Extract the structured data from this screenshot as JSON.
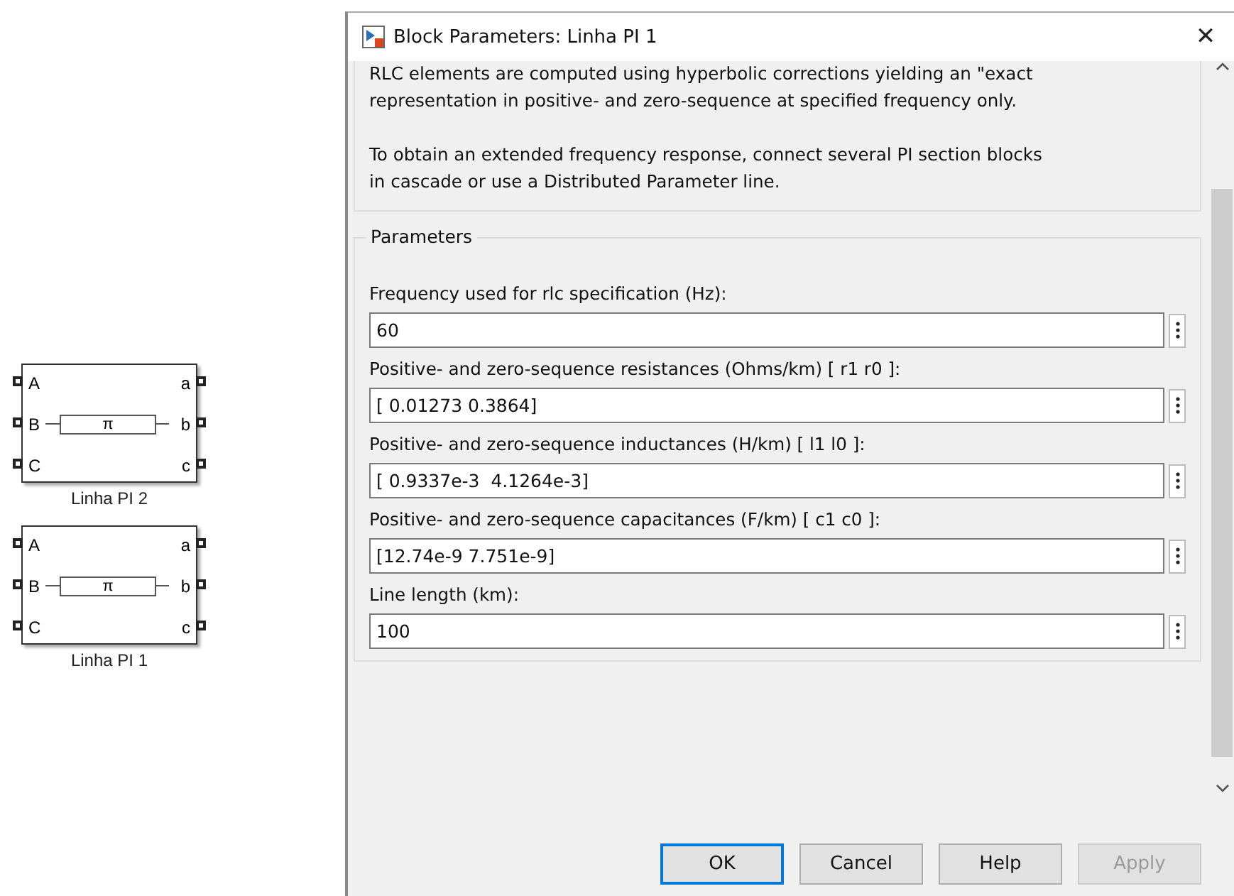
{
  "canvas": {
    "blocks": [
      {
        "name": "Linha PI 2",
        "left_ports": [
          "A",
          "B",
          "C"
        ],
        "right_ports": [
          "a",
          "b",
          "c"
        ],
        "symbol": "π"
      },
      {
        "name": "Linha PI 1",
        "left_ports": [
          "A",
          "B",
          "C"
        ],
        "right_ports": [
          "a",
          "b",
          "c"
        ],
        "symbol": "π"
      }
    ]
  },
  "dialog": {
    "title": "Block Parameters: Linha PI 1",
    "close": "✕",
    "description": [
      {
        "lines": [
          "RLC elements are computed using hyperbolic corrections yielding an \"exact",
          "representation in positive- and zero-sequence at specified frequency only."
        ]
      },
      {
        "lines": [
          "To obtain an extended frequency response, connect several PI section blocks",
          "in cascade or use a Distributed Parameter line."
        ]
      }
    ],
    "parameters": {
      "title": "Parameters",
      "fields": [
        {
          "label": "Frequency used for rlc specification (Hz):",
          "value": "60"
        },
        {
          "label": "Positive- and zero-sequence resistances (Ohms/km) [ r1  r0 ]:",
          "value": "[ 0.01273 0.3864]"
        },
        {
          "label": "Positive- and zero-sequence inductances (H/km) [ l1  l0 ]:",
          "value": "[ 0.9337e-3  4.1264e-3]"
        },
        {
          "label": "Positive- and zero-sequence capacitances (F/km) [ c1 c0 ]:",
          "value": "[12.74e-9 7.751e-9]"
        },
        {
          "label": "Line length (km):",
          "value": "100"
        }
      ]
    },
    "buttons": [
      {
        "label": "OK",
        "default": true,
        "disabled": false
      },
      {
        "label": "Cancel",
        "default": false,
        "disabled": false
      },
      {
        "label": "Help",
        "default": false,
        "disabled": false
      },
      {
        "label": "Apply",
        "default": false,
        "disabled": true
      }
    ]
  }
}
